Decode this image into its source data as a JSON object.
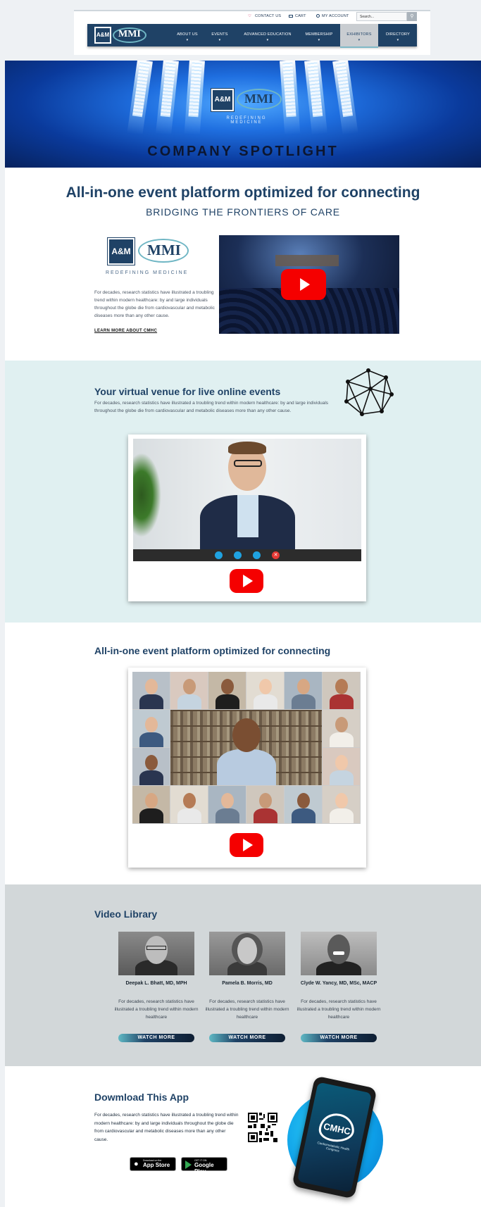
{
  "header": {
    "utility": [
      {
        "label": "CONTACT US",
        "icon": "heart-icon"
      },
      {
        "label": "CART",
        "icon": "cart-icon"
      },
      {
        "label": "MY ACCOUNT",
        "icon": "user-icon"
      }
    ],
    "search_placeholder": "Search...",
    "nav": [
      "ABOUT US",
      "EVENTS",
      "ADVANCED EDUCATION",
      "MEMBERSHIP",
      "EXHIBITORS",
      "DIRECTORY"
    ],
    "active_nav": "EXHIBITORS",
    "logo_left": "A&M",
    "logo_right": "MMI"
  },
  "hero": {
    "logo_left": "A&M",
    "logo_right": "MMI",
    "tagline": "REDEFINING MEDICINE",
    "title": "COMPANY SPOTLIGHT"
  },
  "intro": {
    "heading": "All-in-one event platform optimized for connecting",
    "subheading": "BRIDGING THE FRONTIERS OF CARE",
    "logo_left": "A&M",
    "logo_right": "MMI",
    "tagline": "REDEFINING MEDICINE",
    "body": "For decades, research statistics have illustrated a troubling trend within modern healthcare: by and large individuals throughout the globe die from cardiovascular and metabolic diseases more than any other cause.",
    "link": "LEARN MORE ABOUT CMHC"
  },
  "virtual": {
    "heading": "Your virtual venue for live online events",
    "body": "For decades, research statistics have illustrated a troubling trend within modern healthcare: by and large individuals throughout the globe die from cardiovascular and metabolic diseases more than any other cause."
  },
  "grid_section": {
    "heading": "All-in-one event platform optimized for connecting"
  },
  "library": {
    "heading": "Video Library",
    "speakers": [
      {
        "name": "Deepak L. Bhatt, MD, MPH",
        "desc": "For decades, research statistics have illustrated a troubling trend within modern healthcare",
        "button": "WATCH MORE"
      },
      {
        "name": "Pamela B. Morris, MD",
        "desc": "For decades, research statistics have illustrated a troubling trend within modern healthcare",
        "button": "WATCH MORE"
      },
      {
        "name": "Clyde W. Yancy, MD, MSc, MACP",
        "desc": "For decades, research statistics have illustrated a troubling trend within modern healthcare",
        "button": "WATCH MORE"
      }
    ]
  },
  "app": {
    "heading": "Dowmload This App",
    "body": "For decades, research statistics have illustrated a troubling trend within modern healthcare: by and large individuals throughout the globe die from cardiovascular and metabolic diseases more than any other cause.",
    "appstore_small": "Download on the",
    "appstore_big": "App Store",
    "googleplay_small": "GET IT ON",
    "googleplay_big": "Google Play",
    "phone_logo": "CMHC",
    "phone_sub": "Cardiometabolic Health Congress"
  },
  "colors": {
    "navy": "#1f4266",
    "teal": "#6fb6c4",
    "youtube": "#f50000"
  }
}
